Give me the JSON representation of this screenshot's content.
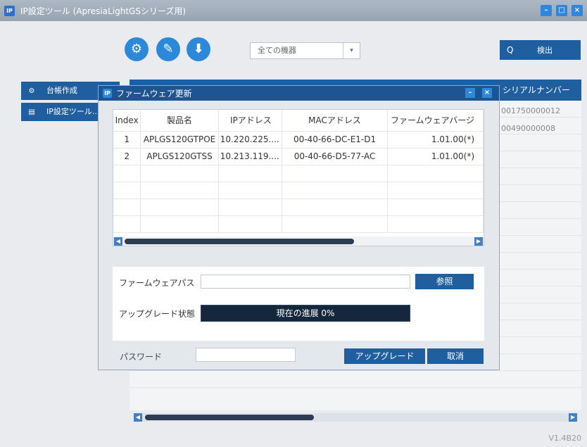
{
  "window": {
    "logo": "IP",
    "title": "IP設定ツール (ApresiaLightGSシリーズ用)",
    "minimize_icon": "–",
    "maximize_icon": "□",
    "close_icon": "×"
  },
  "toolbar": {
    "settings_icon": "⚙",
    "key_icon": "✎",
    "download_icon": "⬇",
    "device_filter": "全ての機器",
    "filter_caret": "▾",
    "search_icon": "Q",
    "detect_label": "検出"
  },
  "sidebar": {
    "items": [
      {
        "icon": "⚙",
        "label": "台帳作成"
      },
      {
        "icon": "▤",
        "label": "IP設定ツール..."
      }
    ]
  },
  "background_table": {
    "serial_header": "シリアルナンバー",
    "serial_values": [
      "001750000012",
      "00490000008"
    ]
  },
  "version": "V1.4B20",
  "dialog": {
    "logo": "IP",
    "title": "ファームウェア更新",
    "minimize_icon": "–",
    "close_icon": "×",
    "columns": [
      "Index",
      "製品名",
      "IPアドレス",
      "MACアドレス",
      "ファームウェアバージ"
    ],
    "rows": [
      [
        "1",
        "APLGS120GTPOE",
        "10.220.225....",
        "00-40-66-DC-E1-D1",
        "1.01.00(*)"
      ],
      [
        "2",
        "APLGS120GTSS",
        "10.213.119....",
        "00-40-66-D5-77-AC",
        "1.01.00(*)"
      ],
      [
        "",
        "",
        "",
        "",
        ""
      ],
      [
        "",
        "",
        "",
        "",
        ""
      ],
      [
        "",
        "",
        "",
        "",
        ""
      ],
      [
        "",
        "",
        "",
        "",
        ""
      ]
    ],
    "scroll_left": "◀",
    "scroll_right": "▶",
    "firmware_path_label": "ファームウェアパス",
    "firmware_path_value": "",
    "browse_label": "参照",
    "upgrade_status_label": "アップグレード状態",
    "progress_text": "現在の進展 0%",
    "progress_percent": 0,
    "password_label": "パスワード",
    "password_value": "",
    "upgrade_label": "アップグレード",
    "cancel_label": "取消"
  }
}
